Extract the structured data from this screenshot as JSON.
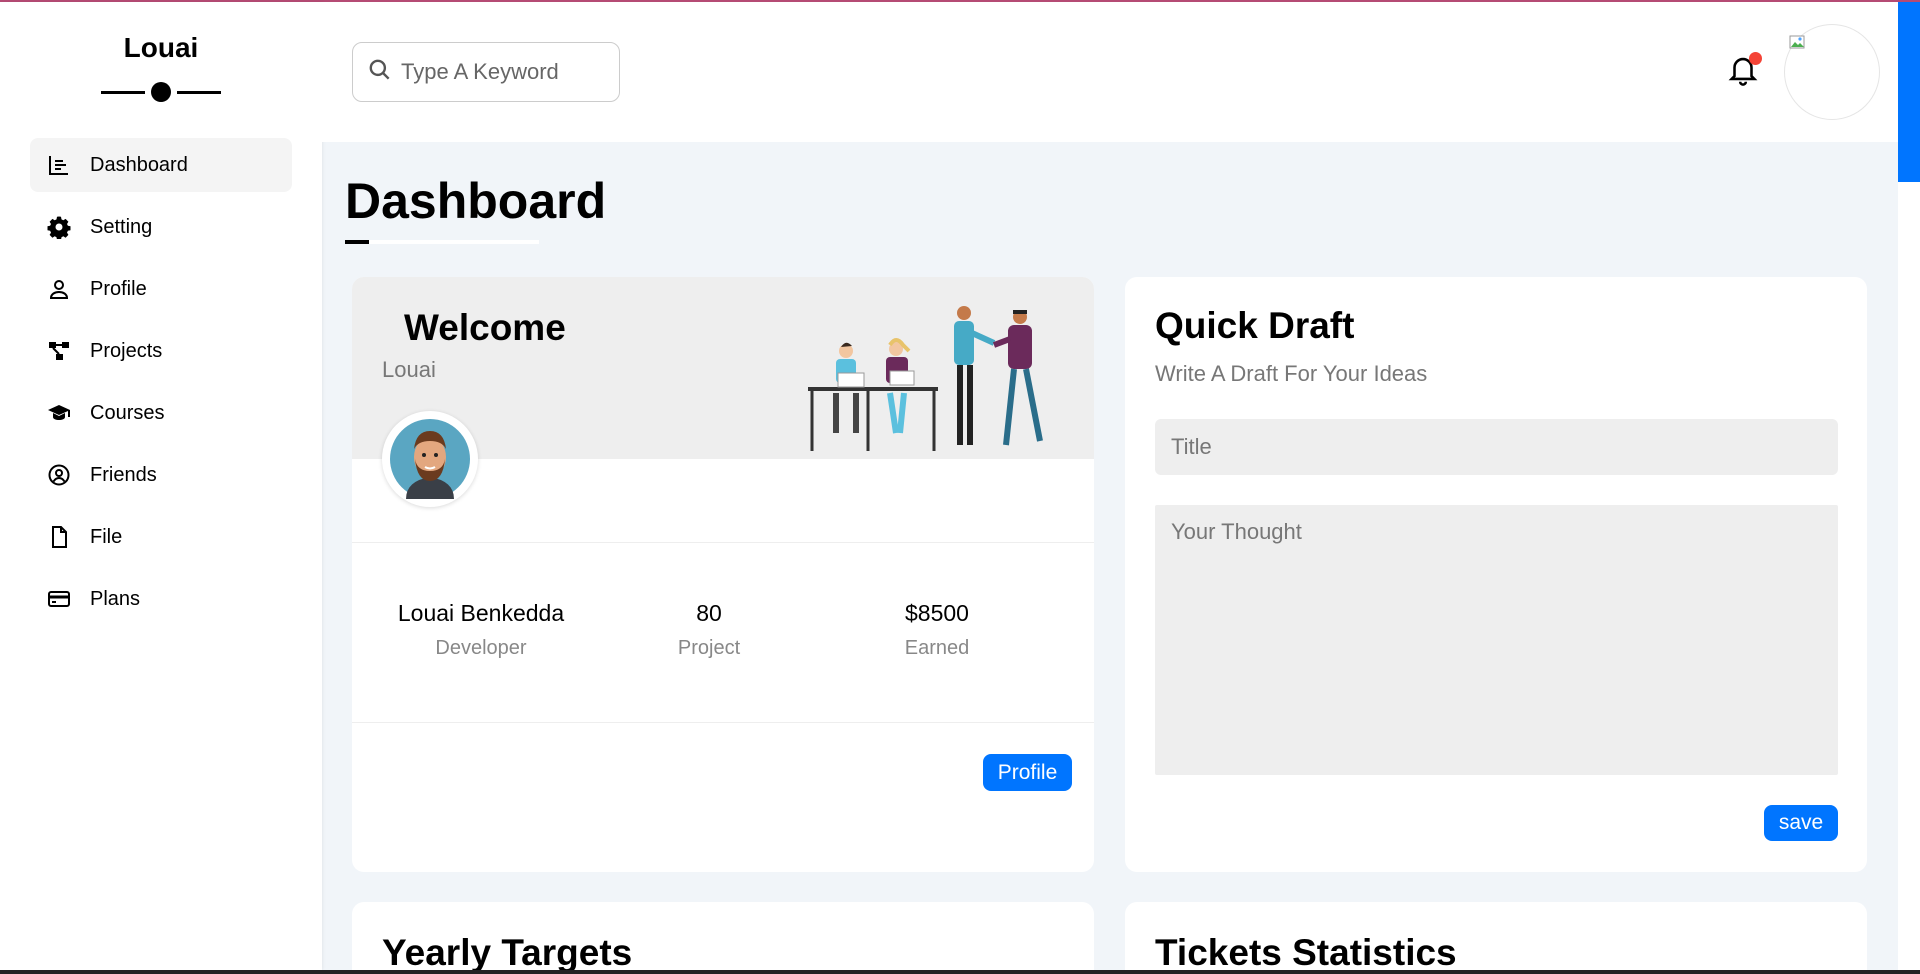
{
  "sidebar": {
    "brand": "Louai",
    "items": [
      {
        "label": "Dashboard",
        "icon": "chart-icon",
        "active": true
      },
      {
        "label": "Setting",
        "icon": "gear-icon",
        "active": false
      },
      {
        "label": "Profile",
        "icon": "user-icon",
        "active": false
      },
      {
        "label": "Projects",
        "icon": "diagram-project-icon",
        "active": false
      },
      {
        "label": "Courses",
        "icon": "graduation-cap-icon",
        "active": false
      },
      {
        "label": "Friends",
        "icon": "user-circle-icon",
        "active": false
      },
      {
        "label": "File",
        "icon": "file-icon",
        "active": false
      },
      {
        "label": "Plans",
        "icon": "credit-card-icon",
        "active": false
      }
    ]
  },
  "header": {
    "search_placeholder": "Type A Keyword",
    "notification_badge_color": "#f44336"
  },
  "page": {
    "title": "Dashboard"
  },
  "welcome": {
    "title": "Welcome",
    "name": "Louai",
    "stats": [
      {
        "value": "Louai Benkedda",
        "label": "Developer"
      },
      {
        "value": "80",
        "label": "Project"
      },
      {
        "value": "$8500",
        "label": "Earned"
      }
    ],
    "button": "Profile"
  },
  "draft": {
    "title": "Quick Draft",
    "subtitle": "Write A Draft For Your Ideas",
    "title_placeholder": "Title",
    "thought_placeholder": "Your Thought",
    "button": "save"
  },
  "bottom": {
    "yearly_title": "Yearly Targets",
    "tickets_title": "Tickets Statistics"
  },
  "colors": {
    "accent": "#0075ff",
    "background": "#f1f5f9"
  }
}
